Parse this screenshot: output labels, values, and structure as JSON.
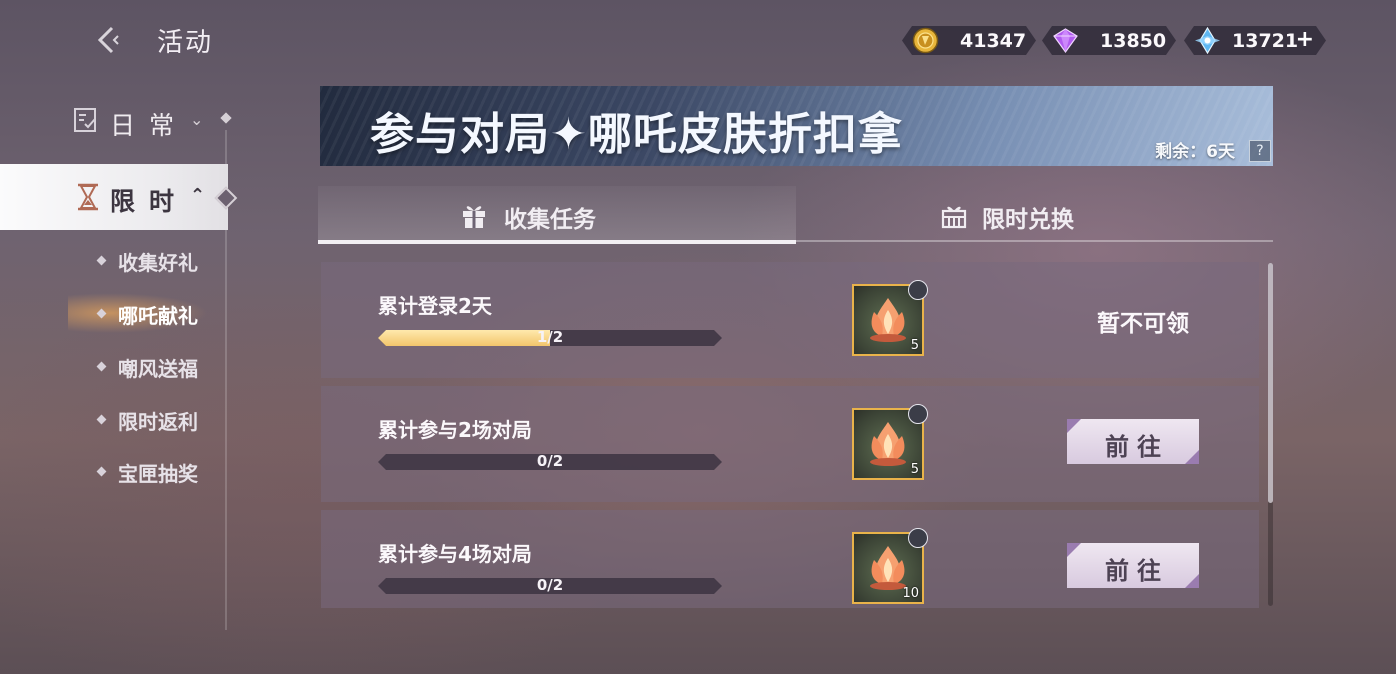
{
  "header": {
    "title": "活动",
    "currencies": [
      {
        "icon": "gold-coin-icon",
        "value": "41347"
      },
      {
        "icon": "purple-diamond-icon",
        "value": "13850"
      },
      {
        "icon": "blue-crystal-icon",
        "value": "13721"
      }
    ],
    "add_label": "+"
  },
  "sidebar": {
    "categories": [
      {
        "label": "日常",
        "icon": "daily-calendar-icon",
        "expanded": false
      },
      {
        "label": "限时",
        "icon": "hourglass-icon",
        "expanded": true,
        "selected": true
      }
    ],
    "items": [
      {
        "label": "收集好礼"
      },
      {
        "label": "哪吒献礼",
        "active": true
      },
      {
        "label": "嘲风送福"
      },
      {
        "label": "限时返利"
      },
      {
        "label": "宝匣抽奖"
      }
    ]
  },
  "banner": {
    "title": "参与对局✦哪吒皮肤折扣拿",
    "remaining": "剩余：6天",
    "help": "?"
  },
  "tabs": [
    {
      "label": "收集任务",
      "icon": "gift-icon",
      "selected": true
    },
    {
      "label": "限时兑换",
      "icon": "exchange-gift-icon",
      "selected": false
    }
  ],
  "tasks": [
    {
      "name": "累计登录2天",
      "progress_text": "1/2",
      "progress": 0.5,
      "reward_icon": "lotus-flame-icon",
      "reward_count": "5",
      "status": "暂不可领",
      "button": null
    },
    {
      "name": "累计参与2场对局",
      "progress_text": "0/2",
      "progress": 0,
      "reward_icon": "lotus-flame-icon",
      "reward_count": "5",
      "status": null,
      "button": "前往"
    },
    {
      "name": "累计参与4场对局",
      "progress_text": "0/2",
      "progress": 0,
      "reward_icon": "lotus-flame-icon",
      "reward_count": "10",
      "status": null,
      "button": "前往"
    }
  ],
  "colors": {
    "accent_gold": "#f2c56c",
    "button_bg": "#e4d8e8",
    "button_corner": "#9a7cb0"
  }
}
